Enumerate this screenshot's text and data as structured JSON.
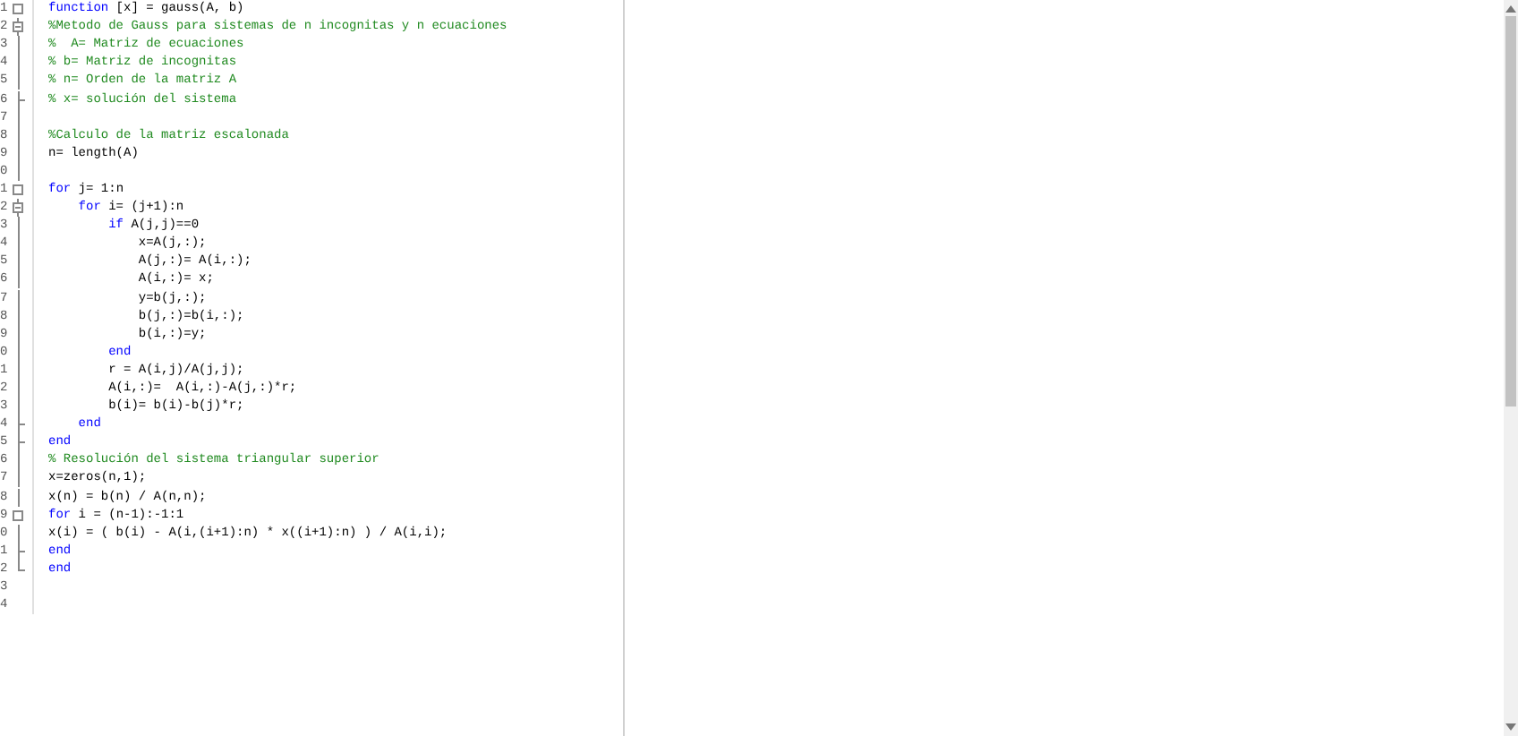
{
  "editor": {
    "lines": [
      {
        "number": "1",
        "kind": "collapsed",
        "segments": [
          {
            "kind": "keyword",
            "text": "function"
          },
          {
            "kind": "code",
            "text": " [x] = gauss(A, b)"
          }
        ]
      },
      {
        "number": "2",
        "kind": "expanded",
        "segments": [
          {
            "kind": "comment",
            "text": "%Metodo de Gauss para sistemas de n incognitas y n ecuaciones"
          }
        ]
      },
      {
        "number": "3",
        "kind": "inner",
        "segments": [
          {
            "kind": "comment",
            "text": "%  A= Matriz de ecuaciones"
          }
        ]
      },
      {
        "number": "4",
        "kind": "inner",
        "segments": [
          {
            "kind": "comment",
            "text": "% b= Matriz de incognitas"
          }
        ]
      },
      {
        "number": "5",
        "kind": "inner",
        "segments": [
          {
            "kind": "comment",
            "text": "% n= Orden de la matriz A"
          }
        ]
      },
      {
        "number": "6",
        "kind": "end",
        "segments": [
          {
            "kind": "comment",
            "text": "% x= solución del sistema"
          }
        ]
      },
      {
        "number": "7",
        "kind": "inner"
      },
      {
        "number": "8",
        "kind": "inner",
        "segments": [
          {
            "kind": "comment",
            "text": "%Calculo de la matriz escalonada"
          }
        ]
      },
      {
        "number": "9",
        "kind": "inner",
        "segments": [
          {
            "kind": "code",
            "text": "n= length(A)"
          }
        ]
      },
      {
        "number": "0",
        "kind": "inner"
      },
      {
        "number": "1",
        "kind": "collapsed",
        "segments": [
          {
            "kind": "keyword",
            "text": "for"
          },
          {
            "kind": "code",
            "text": " j= 1:n"
          }
        ]
      },
      {
        "number": "2",
        "kind": "expanded",
        "segments": [
          {
            "kind": "keyword",
            "text": "    for"
          },
          {
            "kind": "code",
            "text": " i= (j+1):n"
          }
        ]
      },
      {
        "number": "3",
        "kind": "inner",
        "segments": [
          {
            "kind": "keyword",
            "text": "        if"
          },
          {
            "kind": "code",
            "text": " A(j,j)==0"
          }
        ]
      },
      {
        "number": "4",
        "kind": "inner",
        "segments": [
          {
            "kind": "code",
            "text": "            x=A(j,:);"
          }
        ]
      },
      {
        "number": "5",
        "kind": "inner",
        "segments": [
          {
            "kind": "code",
            "text": "            A(j,:)= A(i,:);"
          }
        ]
      },
      {
        "number": "6",
        "kind": "inner",
        "segments": [
          {
            "kind": "code",
            "text": "            A(i,:)= x;"
          }
        ]
      },
      {
        "number": "7",
        "kind": "inner",
        "segments": [
          {
            "kind": "code",
            "text": "            y=b(j,:);"
          }
        ]
      },
      {
        "number": "8",
        "kind": "inner",
        "segments": [
          {
            "kind": "code",
            "text": "            b(j,:)=b(i,:);"
          }
        ]
      },
      {
        "number": "9",
        "kind": "inner",
        "segments": [
          {
            "kind": "code",
            "text": "            b(i,:)=y;"
          }
        ]
      },
      {
        "number": "0",
        "kind": "inner",
        "segments": [
          {
            "kind": "keyword",
            "text": "        end"
          }
        ]
      },
      {
        "number": "1",
        "kind": "inner",
        "segments": [
          {
            "kind": "code",
            "text": "        r = A(i,j)/A(j,j);"
          }
        ]
      },
      {
        "number": "2",
        "kind": "inner",
        "segments": [
          {
            "kind": "code",
            "text": "        A(i,:)=  A(i,:)-A(j,:)*r;"
          }
        ]
      },
      {
        "number": "3",
        "kind": "inner",
        "segments": [
          {
            "kind": "code",
            "text": "        b(i)= b(i)-b(j)*r;"
          }
        ]
      },
      {
        "number": "4",
        "kind": "end",
        "segments": [
          {
            "kind": "keyword",
            "text": "    end"
          }
        ]
      },
      {
        "number": "5",
        "kind": "end",
        "segments": [
          {
            "kind": "keyword",
            "text": "end"
          }
        ]
      },
      {
        "number": "6",
        "kind": "inner",
        "segments": [
          {
            "kind": "comment",
            "text": "% Resolución del sistema triangular superior"
          }
        ]
      },
      {
        "number": "7",
        "kind": "inner",
        "segments": [
          {
            "kind": "code",
            "text": "x=zeros(n,1);"
          }
        ]
      },
      {
        "number": "8",
        "kind": "inner",
        "segments": [
          {
            "kind": "code",
            "text": "x(n) = b(n) / A(n,n);"
          }
        ]
      },
      {
        "number": "9",
        "kind": "collapsed",
        "segments": [
          {
            "kind": "keyword",
            "text": "for"
          },
          {
            "kind": "code",
            "text": " i = (n-1):-1:1"
          }
        ]
      },
      {
        "number": "0",
        "kind": "inner",
        "segments": [
          {
            "kind": "code",
            "text": "x(i) = ( b(i) - A(i,(i+1):n) * x((i+1):n) ) / A(i,i);"
          }
        ]
      },
      {
        "number": "1",
        "kind": "end",
        "segments": [
          {
            "kind": "keyword",
            "text": "end"
          }
        ]
      },
      {
        "number": "2",
        "kind": "last",
        "segments": [
          {
            "kind": "keyword",
            "text": "end"
          }
        ]
      },
      {
        "number": "3"
      },
      {
        "number": "4"
      }
    ]
  }
}
